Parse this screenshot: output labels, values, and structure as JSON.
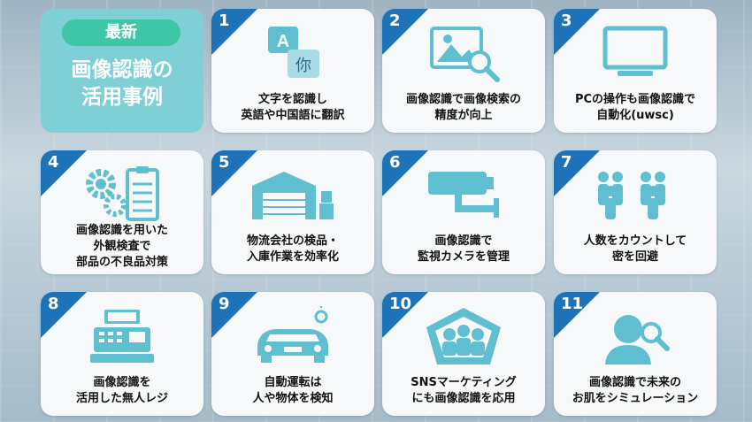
{
  "title": {
    "badge": "最新",
    "line1": "画像認識の",
    "line2": "活用事例"
  },
  "icon_color": "#5fbfd0",
  "accent_color": "#1e72b8",
  "cards": [
    {
      "num": "1",
      "icon": "translate-icon",
      "line1": "文字を認識し",
      "line2": "英語や中国語に翻訳"
    },
    {
      "num": "2",
      "icon": "image-search-icon",
      "line1": "画像認識で画像検索の",
      "line2": "精度が向上"
    },
    {
      "num": "3",
      "icon": "monitor-icon",
      "line1": "PCの操作も画像認識で",
      "line2": "自動化(uwsc)"
    },
    {
      "num": "4",
      "icon": "gears-clipboard-icon",
      "line1": "画像認識を用いた",
      "line2": "外観検査で",
      "line3": "部品の不良品対策"
    },
    {
      "num": "5",
      "icon": "warehouse-icon",
      "line1": "物流会社の検品・",
      "line2": "入庫作業を効率化"
    },
    {
      "num": "6",
      "icon": "security-camera-icon",
      "line1": "画像認識で",
      "line2": "監視カメラを管理"
    },
    {
      "num": "7",
      "icon": "crowd-icon",
      "line1": "人数をカウントして",
      "line2": "密を回避"
    },
    {
      "num": "8",
      "icon": "cash-register-icon",
      "line1": "画像認識を",
      "line2": "活用した無人レジ"
    },
    {
      "num": "9",
      "icon": "car-icon",
      "line1": "自動運転は",
      "line2": "人や物体を検知"
    },
    {
      "num": "10",
      "icon": "sns-group-icon",
      "line1": "SNSマーケティング",
      "line2": "にも画像認識を応用"
    },
    {
      "num": "11",
      "icon": "face-search-icon",
      "line1": "画像認識で未来の",
      "line2": "お肌をシミュレーション"
    }
  ]
}
